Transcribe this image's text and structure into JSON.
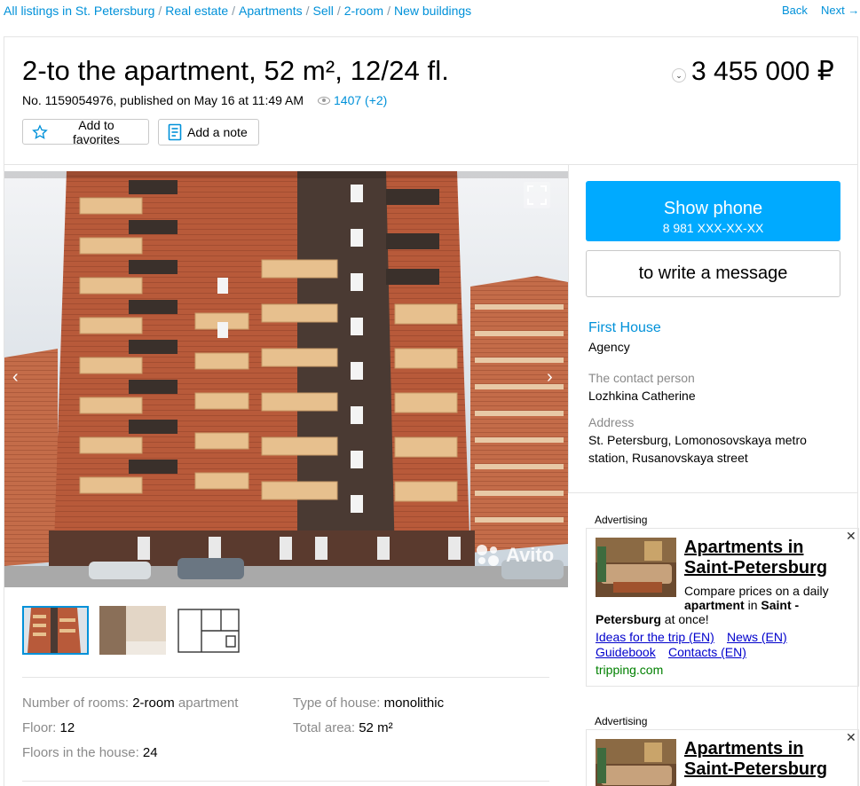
{
  "breadcrumbs": [
    "All listings in St. Petersburg",
    "Real estate",
    "Apartments",
    "Sell",
    "2-room",
    "New buildings"
  ],
  "nav": {
    "back": "Back",
    "next": "Next →"
  },
  "listing": {
    "title": "2-to the apartment, 52 m², 12/24 fl.",
    "price": "3 455 000  ₽",
    "meta": "No. 1159054976, published on May 16 at 11:49 AM",
    "views": "1407 (+2)",
    "favorites_label": "Add to favorites",
    "note_label": "Add a note"
  },
  "gallery": {
    "watermark": "Avito",
    "selected_index": 0
  },
  "params": {
    "rooms_label": "Number of rooms:",
    "rooms_value": "2-room",
    "rooms_unit": "apartment",
    "floor_label": "Floor:",
    "floor_value": "12",
    "floors_label": "Floors in the house:",
    "floors_value": "24",
    "house_type_label": "Type of house:",
    "house_type_value": "monolithic",
    "area_label": "Total area:",
    "area_value": "52 m²"
  },
  "contact": {
    "show_phone": "Show phone",
    "phone_masked": "8 981 XXX-XX-XX",
    "write_message": "to write a message",
    "seller_name": "First House",
    "seller_type": "Agency",
    "contact_label": "The contact person",
    "contact_name": "Lozhkina Catherine",
    "address_label": "Address",
    "address_line1": "St. Petersburg, Lomonosovskaya metro",
    "address_line2": "station, Rusanovskaya street"
  },
  "ads": [
    {
      "label": "Advertising",
      "title_line1": "Apartments in",
      "title_line2": "Saint-Petersburg",
      "text_a": "Compare prices on a daily",
      "text_b1": "apartment",
      "text_b2": " in ",
      "text_b3": "Saint -",
      "text_c1": "Petersburg",
      "text_c2": " at once!",
      "link1": "Ideas for the trip (EN)",
      "link2": "News (EN)",
      "link3": "Guidebook",
      "link4": "Contacts (EN)",
      "domain": "tripping.com"
    },
    {
      "label": "Advertising",
      "title_line1": "Apartments in",
      "title_line2": "Saint-Petersburg"
    }
  ],
  "colors": {
    "accent": "#0091d9",
    "phone_button": "#00aaff",
    "ad_link": "#0000cc",
    "ad_domain": "#008000"
  }
}
